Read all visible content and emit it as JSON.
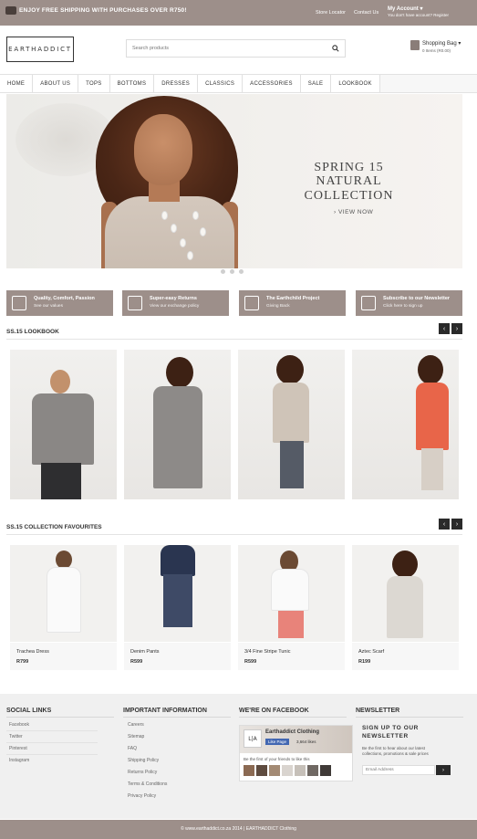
{
  "topbar": {
    "shipping": "ENJOY FREE SHIPPING WITH PURCHASES OVER R750!",
    "store_locator": "Store Locator",
    "contact": "Contact Us",
    "account": "My Account ▾",
    "account_sub": "You don't have account? Register"
  },
  "header": {
    "logo": "EARTHADDICT",
    "search_placeholder": "Search products",
    "bag_label": "Shopping Bag ▾",
    "bag_sub": "0 Items (R0.00)"
  },
  "nav": [
    "HOME",
    "ABOUT US",
    "TOPS",
    "BOTTOMS",
    "DRESSES",
    "CLASSICS",
    "ACCESSORIES",
    "SALE",
    "LOOKBOOK"
  ],
  "hero": {
    "line1": "SPRING 15",
    "line2": "NATURAL COLLECTION",
    "cta": "› VIEW NOW"
  },
  "features": [
    {
      "title": "Quality, Comfort, Passion",
      "sub": "See our values",
      "icon": "badge-icon"
    },
    {
      "title": "Super-easy Returns",
      "sub": "View our exchange policy",
      "icon": "return-icon"
    },
    {
      "title": "The Earthchild Project",
      "sub": "Giving Back",
      "icon": "gift-icon"
    },
    {
      "title": "Subscribe to our Newsletter",
      "sub": "Click here to sign up",
      "icon": "mail-icon"
    }
  ],
  "lookbook_title": "SS.15 LOOKBOOK",
  "favourites_title": "SS.15 COLLECTION FAVOURITES",
  "products": [
    {
      "name": "Trachea Dress",
      "price": "R799"
    },
    {
      "name": "Denim Pants",
      "price": "R599"
    },
    {
      "name": "3/4 Fine Stripe Tunic",
      "price": "R599"
    },
    {
      "name": "Aztec Scarf",
      "price": "R199"
    }
  ],
  "footer": {
    "social_title": "SOCIAL LINKS",
    "social": [
      "Facebook",
      "Twitter",
      "Pinterest",
      "Instagram"
    ],
    "info_title": "IMPORTANT INFORMATION",
    "info": [
      "Careers",
      "Sitemap",
      "FAQ",
      "Shipping Policy",
      "Returns Policy",
      "Terms & Conditions",
      "Privacy Policy"
    ],
    "fb_title": "WE'RE ON FACEBOOK",
    "fb_page": "Earthaddict Clothing",
    "fb_like": "Like Page",
    "fb_count": "3,664 likes",
    "fb_friends": "Be the first of your friends to like this",
    "news_title": "NEWSLETTER",
    "news_line1": "SIGN UP TO OUR",
    "news_line2": "NEWSLETTER",
    "news_desc": "Be the first to hear about our latest collections, promotions & sale prices",
    "news_placeholder": "Email Address",
    "copyright": "© www.earthaddict.co.za 2014 | EARTHADDICT Clothing"
  }
}
